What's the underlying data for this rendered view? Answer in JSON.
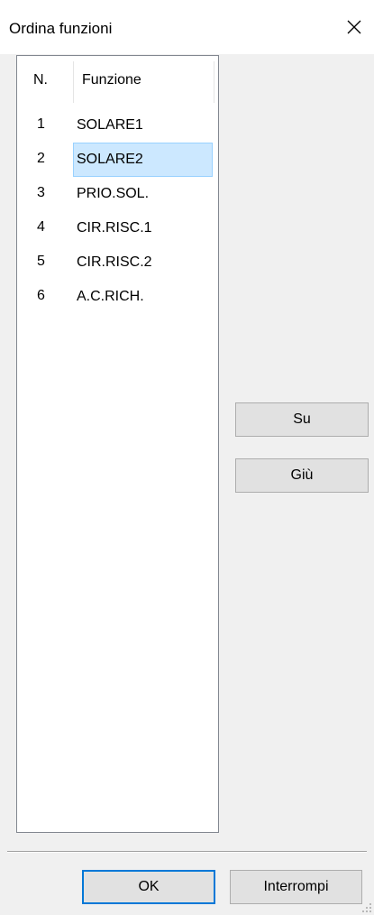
{
  "window": {
    "title": "Ordina funzioni"
  },
  "list": {
    "headers": {
      "number": "N.",
      "function": "Funzione"
    },
    "rows": [
      {
        "number": "1",
        "function": "SOLARE1",
        "selected": false
      },
      {
        "number": "2",
        "function": "SOLARE2",
        "selected": true
      },
      {
        "number": "3",
        "function": "PRIO.SOL.",
        "selected": false
      },
      {
        "number": "4",
        "function": "CIR.RISC.1",
        "selected": false
      },
      {
        "number": "5",
        "function": "CIR.RISC.2",
        "selected": false
      },
      {
        "number": "6",
        "function": "A.C.RICH.",
        "selected": false
      }
    ]
  },
  "buttons": {
    "up": "Su",
    "down": "Giù",
    "ok": "OK",
    "cancel": "Interrompi"
  },
  "icons": {
    "close": "close-icon",
    "resize": "resize-grip-icon"
  },
  "colors": {
    "selection_background": "#cce8ff",
    "selection_border": "#99d1ff",
    "default_button_border": "#0078d7"
  }
}
